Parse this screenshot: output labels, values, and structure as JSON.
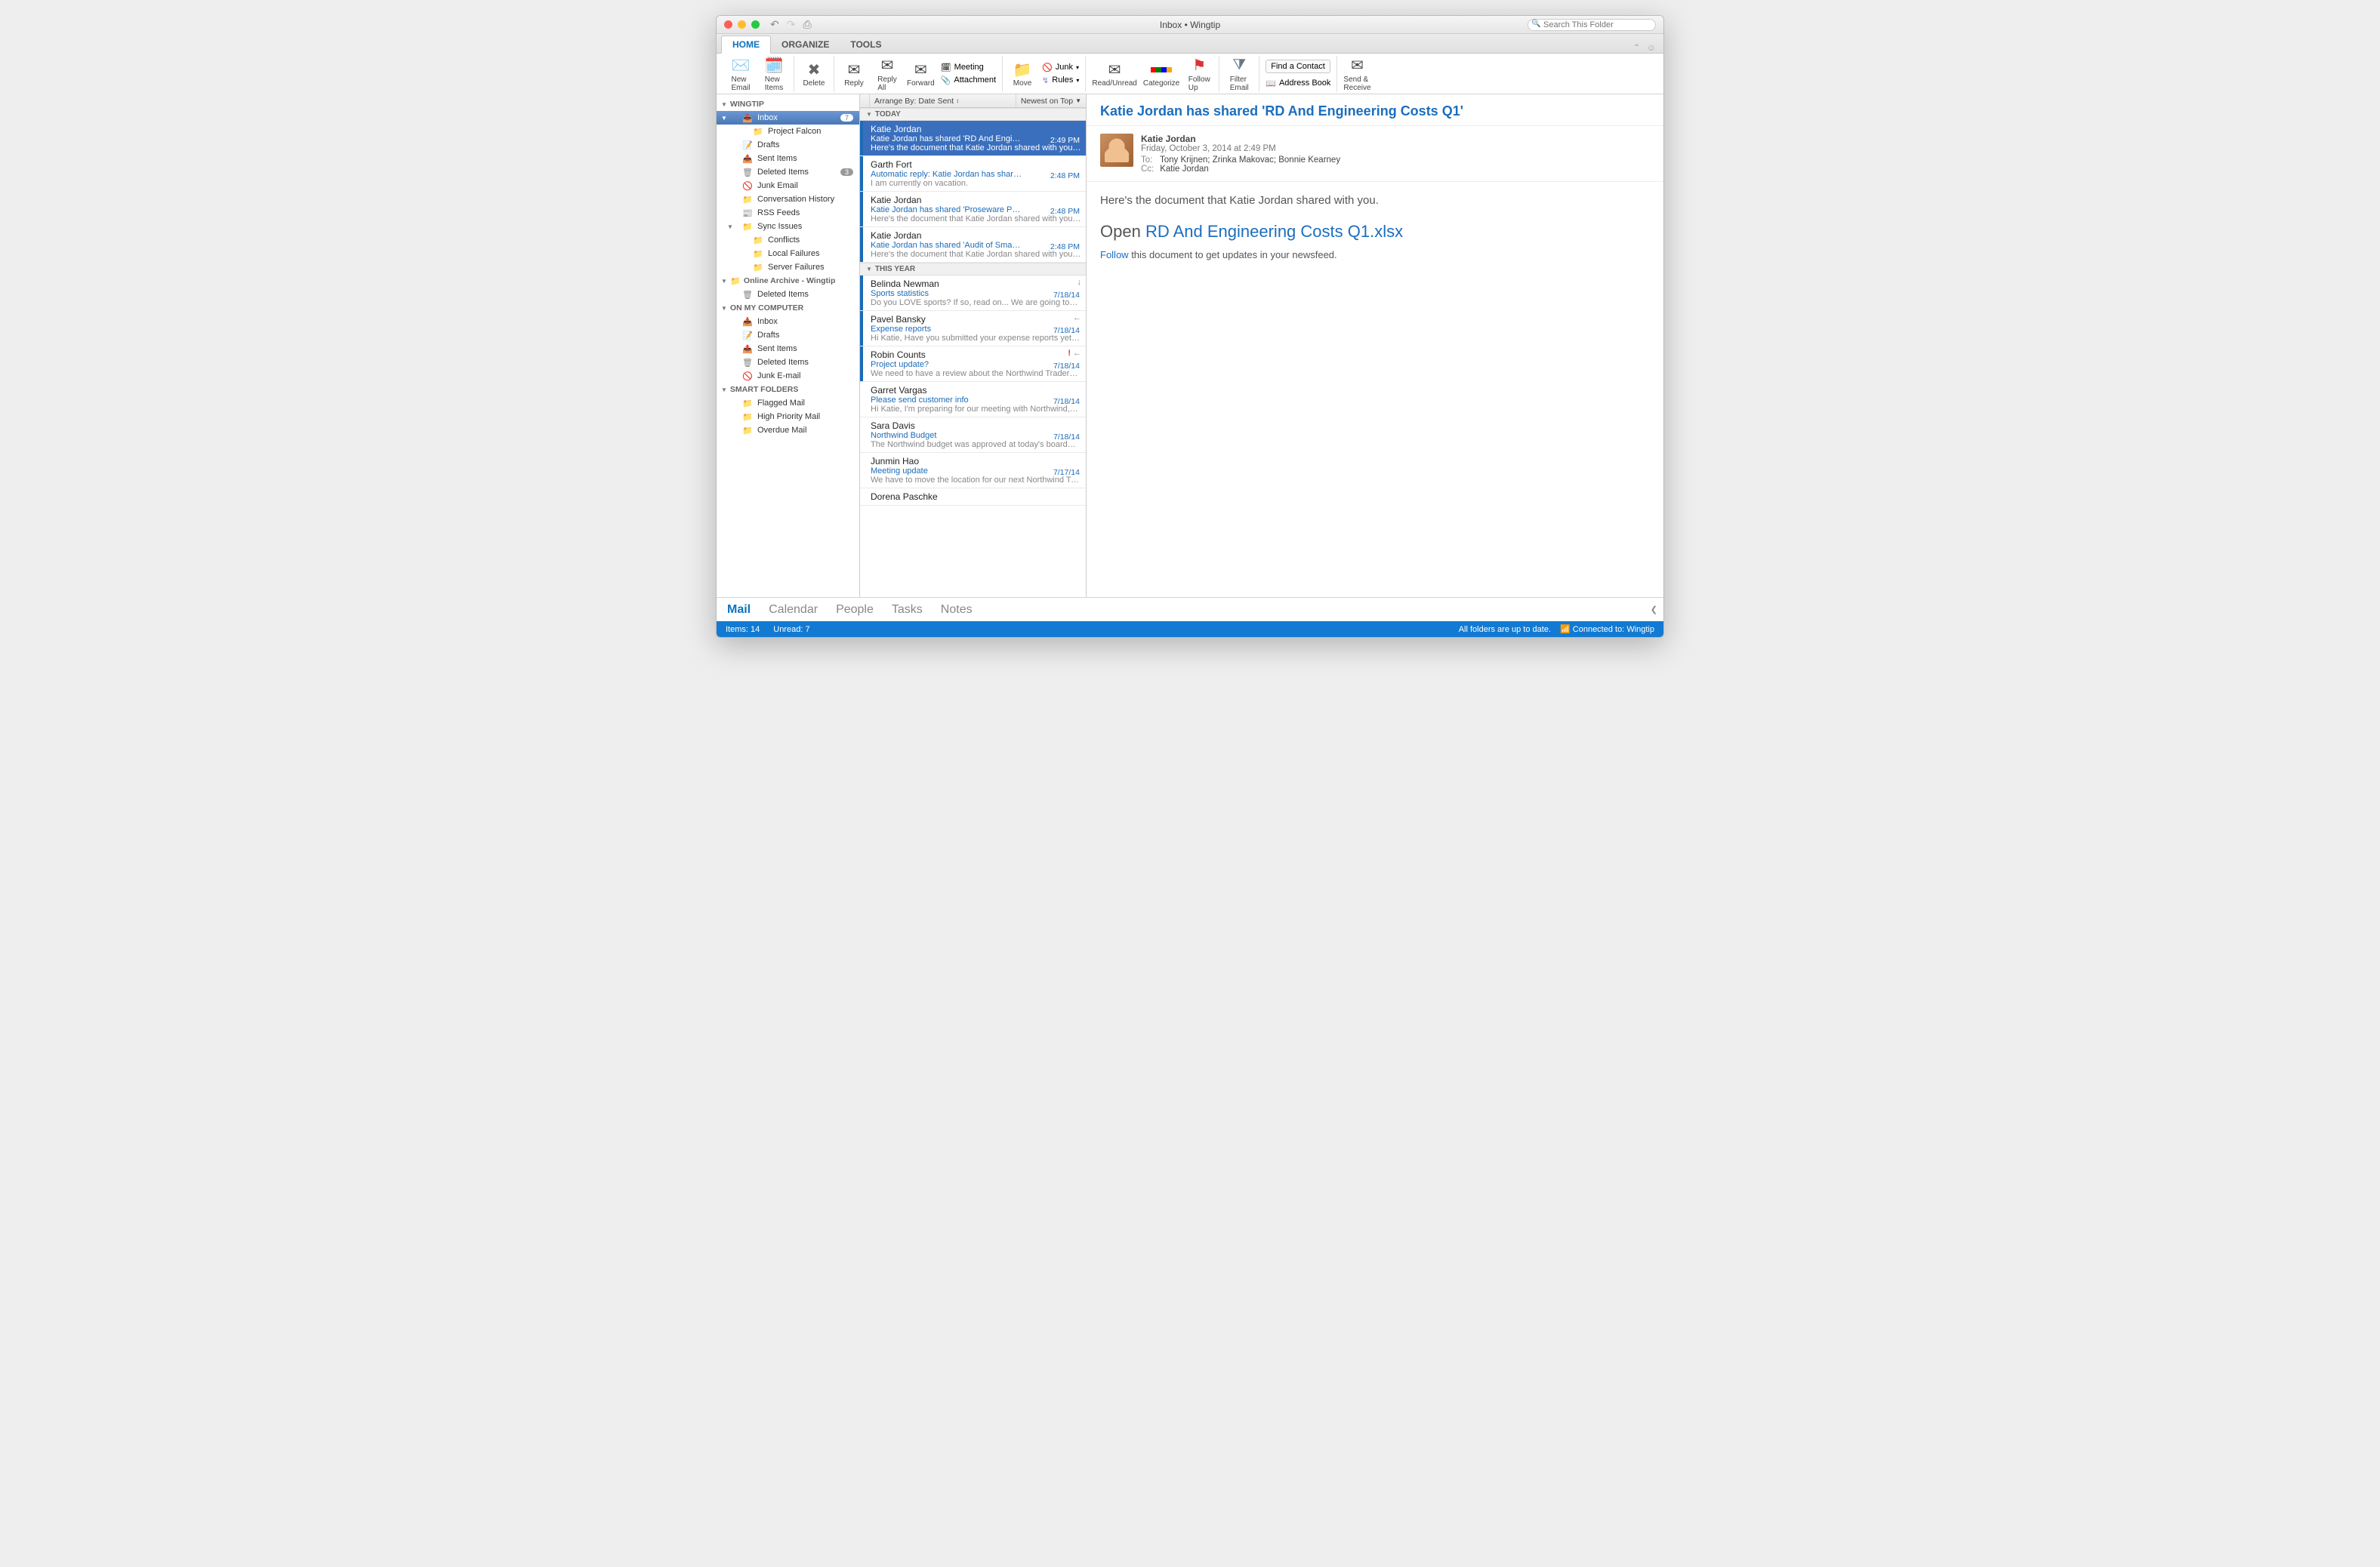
{
  "window": {
    "title": "Inbox • Wingtip"
  },
  "search": {
    "placeholder": "Search This Folder"
  },
  "tabs": [
    "HOME",
    "ORGANIZE",
    "TOOLS"
  ],
  "ribbon": {
    "newEmail": "New\nEmail",
    "newItems": "New\nItems",
    "delete": "Delete",
    "reply": "Reply",
    "replyAll": "Reply\nAll",
    "forward": "Forward",
    "meeting": "Meeting",
    "attachment": "Attachment",
    "move": "Move",
    "junk": "Junk",
    "rules": "Rules",
    "readUnread": "Read/Unread",
    "categorize": "Categorize",
    "followUp": "Follow\nUp",
    "filter": "Filter\nEmail",
    "findContact": "Find a Contact",
    "addressBook": "Address Book",
    "sendReceive": "Send &\nReceive"
  },
  "sidebar": {
    "accounts": [
      {
        "name": "WINGTIP",
        "folders": [
          {
            "label": "Inbox",
            "badge": "7",
            "selected": true,
            "icon": "inbox",
            "children": [
              {
                "label": "Project Falcon",
                "icon": "folder"
              }
            ]
          },
          {
            "label": "Drafts",
            "icon": "drafts"
          },
          {
            "label": "Sent Items",
            "icon": "sent"
          },
          {
            "label": "Deleted Items",
            "badge": "3",
            "icon": "trash"
          },
          {
            "label": "Junk Email",
            "icon": "junk"
          },
          {
            "label": "Conversation History",
            "icon": "folder"
          },
          {
            "label": "RSS Feeds",
            "icon": "rss"
          },
          {
            "label": "Sync Issues",
            "icon": "folder",
            "expand": true,
            "children": [
              {
                "label": "Conflicts",
                "icon": "folder"
              },
              {
                "label": "Local Failures",
                "icon": "folder"
              },
              {
                "label": "Server Failures",
                "icon": "folder"
              }
            ]
          }
        ]
      },
      {
        "name": "Online Archive - Wingtip",
        "icon": "folder",
        "folders": [
          {
            "label": "Deleted Items",
            "icon": "trash"
          }
        ]
      },
      {
        "name": "ON MY COMPUTER",
        "folders": [
          {
            "label": "Inbox",
            "icon": "inbox"
          },
          {
            "label": "Drafts",
            "icon": "drafts"
          },
          {
            "label": "Sent Items",
            "icon": "sent"
          },
          {
            "label": "Deleted Items",
            "icon": "trash"
          },
          {
            "label": "Junk E-mail",
            "icon": "junk"
          }
        ]
      },
      {
        "name": "SMART FOLDERS",
        "folders": [
          {
            "label": "Flagged Mail",
            "icon": "folder"
          },
          {
            "label": "High Priority Mail",
            "icon": "folder"
          },
          {
            "label": "Overdue Mail",
            "icon": "folder"
          }
        ]
      }
    ]
  },
  "listHeader": {
    "arrange": "Arrange By: Date Sent",
    "sort": "Newest on Top"
  },
  "groups": [
    {
      "label": "TODAY",
      "messages": [
        {
          "from": "Katie Jordan",
          "subject": "Katie Jordan has shared 'RD And Engineeri…",
          "preview": "Here's the document that Katie Jordan shared with you…",
          "time": "2:49 PM",
          "unread": true,
          "selected": true
        },
        {
          "from": "Garth Fort",
          "subject": "Automatic reply: Katie Jordan has shared '…",
          "preview": "I am currently on vacation.",
          "time": "2:48 PM",
          "unread": true
        },
        {
          "from": "Katie Jordan",
          "subject": "Katie Jordan has shared 'Proseware Projec…",
          "preview": "Here's the document that Katie Jordan shared with you…",
          "time": "2:48 PM",
          "unread": true
        },
        {
          "from": "Katie Jordan",
          "subject": "Katie Jordan has shared 'Audit of Small Bu…",
          "preview": "Here's the document that Katie Jordan shared with you…",
          "time": "2:48 PM",
          "unread": true
        }
      ]
    },
    {
      "label": "THIS YEAR",
      "messages": [
        {
          "from": "Belinda Newman",
          "subject": "Sports statistics",
          "preview": "Do you LOVE sports? If so, read on... We are going to…",
          "time": "7/18/14",
          "unread": true,
          "icons": [
            "↓"
          ]
        },
        {
          "from": "Pavel Bansky",
          "subject": "Expense reports",
          "preview": "Hi Katie, Have you submitted your expense reports yet…",
          "time": "7/18/14",
          "unread": true,
          "icons": [
            "←"
          ]
        },
        {
          "from": "Robin Counts",
          "subject": "Project update?",
          "preview": "We need to have a review about the Northwind Traders…",
          "time": "7/18/14",
          "unread": true,
          "icons": [
            "!",
            "←"
          ]
        },
        {
          "from": "Garret Vargas",
          "subject": "Please send customer info",
          "preview": "Hi Katie, I'm preparing for our meeting with Northwind,…",
          "time": "7/18/14"
        },
        {
          "from": "Sara Davis",
          "subject": "Northwind Budget",
          "preview": "The Northwind budget was approved at today's board…",
          "time": "7/18/14"
        },
        {
          "from": "Junmin Hao",
          "subject": "Meeting update",
          "preview": "We have to move the location for our next Northwind Tr…",
          "time": "7/17/14"
        },
        {
          "from": "Dorena Paschke",
          "subject": "",
          "preview": "",
          "time": ""
        }
      ]
    }
  ],
  "reading": {
    "subject": "Katie Jordan has shared 'RD And Engineering Costs Q1'",
    "sender": "Katie Jordan",
    "date": "Friday, October 3, 2014 at 2:49 PM",
    "to": "Tony Krijnen;   Zrinka Makovac;   Bonnie Kearney",
    "cc": "Katie Jordan",
    "lead": "Here's the document that Katie Jordan shared with you.",
    "openPrefix": "Open ",
    "openLink": "RD And Engineering Costs Q1.xlsx",
    "followLink": "Follow",
    "followRest": " this document to get updates in your newsfeed."
  },
  "nav": [
    "Mail",
    "Calendar",
    "People",
    "Tasks",
    "Notes"
  ],
  "status": {
    "items": "Items: 14",
    "unread": "Unread: 7",
    "sync": "All folders are up to date.",
    "connected": "Connected to: Wingtip"
  }
}
